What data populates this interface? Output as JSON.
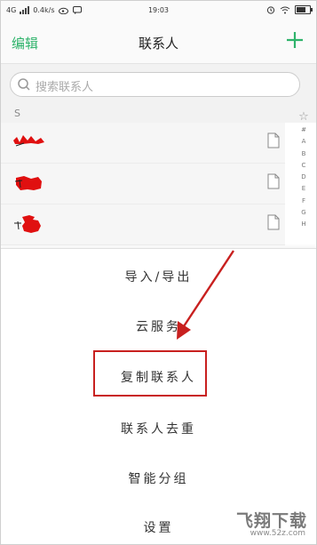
{
  "status_bar": {
    "network": "4G",
    "speed": "0.4k/s",
    "time": "19:03",
    "battery_level": 0.8
  },
  "header": {
    "edit_label": "编辑",
    "title": "联系人",
    "add_icon": "plus-icon"
  },
  "search": {
    "placeholder": "搜索联系人",
    "icon": "search-icon"
  },
  "section": {
    "letter": "S"
  },
  "contacts": [
    {
      "name": "",
      "redacted": true,
      "icon": "contact-card-icon"
    },
    {
      "name": "",
      "redacted": true,
      "icon": "contact-card-icon"
    },
    {
      "name": "",
      "redacted": true,
      "icon": "contact-card-icon"
    }
  ],
  "index_bar": [
    "☆",
    "#",
    "A",
    "B",
    "C",
    "D",
    "E",
    "F",
    "G",
    "H"
  ],
  "menu": {
    "items": [
      "导入/导出",
      "云服务",
      "复制联系人",
      "联系人去重",
      "智能分组",
      "设置"
    ],
    "highlighted_index": 2
  },
  "annotation": {
    "arrow_color": "#c8201f",
    "box_color": "#c8201f"
  },
  "watermark": {
    "brand": "飞翔下载",
    "url": "www.52z.com"
  },
  "colors": {
    "accent_green": "#2fb36b",
    "redaction_red": "#e01010"
  }
}
